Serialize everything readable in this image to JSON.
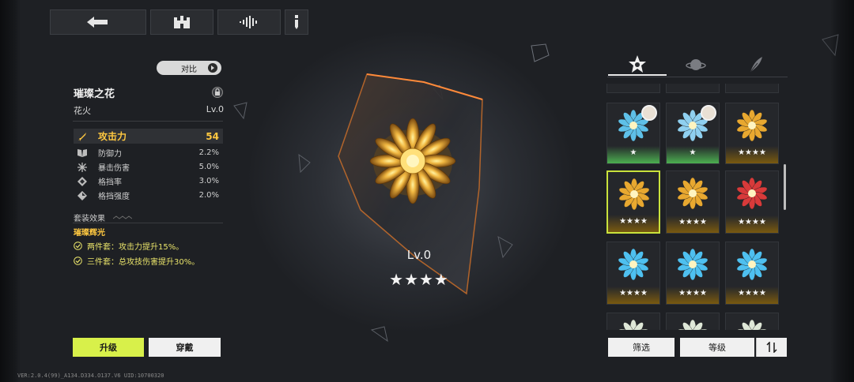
{
  "toolbar": {
    "buttons": [
      {
        "icon": "back-arrow-icon"
      },
      {
        "icon": "castle-icon"
      },
      {
        "icon": "waveform-icon"
      },
      {
        "icon": "info-icon"
      }
    ]
  },
  "left_panel": {
    "compare_label": "对比",
    "item_name": "璀璨之花",
    "item_type": "花火",
    "item_level": "Lv.0",
    "main_stat": {
      "name": "攻击力",
      "value": "54",
      "icon": "sword-icon",
      "color": "#ffc840"
    },
    "sub_stats": [
      {
        "name": "防御力",
        "value": "2.2%",
        "icon": "book-icon"
      },
      {
        "name": "暴击伤害",
        "value": "5.0%",
        "icon": "burst-icon"
      },
      {
        "name": "格挡率",
        "value": "3.0%",
        "icon": "block-icon"
      },
      {
        "name": "格挡强度",
        "value": "2.0%",
        "icon": "block-strength-icon"
      }
    ],
    "set_effect_title": "套装效果",
    "set_name": "璀璨辉光",
    "set_bonuses": [
      "两件套：攻击力提升15%。",
      "三件套：总攻技伤害提升30%。"
    ],
    "upgrade_label": "升级",
    "equip_label": "穿戴",
    "version_text": "VER:2.0.4(99)_A134.D334.O137.V6   UID:10700320"
  },
  "center": {
    "level": "Lv.0",
    "stars": "★★★★",
    "star_count": 4
  },
  "right_panel": {
    "tabs": [
      {
        "icon": "flower-icon",
        "active": true
      },
      {
        "icon": "planet-icon",
        "active": false
      },
      {
        "icon": "feather-icon",
        "active": false
      }
    ],
    "items": [
      {
        "stars": "★",
        "color": "#5ec0e8",
        "glow": "#4caf50",
        "avatar": true
      },
      {
        "stars": "★",
        "color": "#8fd0f0",
        "glow": "#4caf50",
        "avatar": true
      },
      {
        "stars": "★★★★",
        "color": "#e8a830",
        "glow": "#7a5a10",
        "avatar": false
      },
      {
        "stars": "★★★★",
        "color": "#e8a830",
        "glow": "#7a5a10",
        "avatar": false,
        "selected": true
      },
      {
        "stars": "★★★★",
        "color": "#e8a830",
        "glow": "#7a5a10",
        "avatar": false
      },
      {
        "stars": "★★★★",
        "color": "#d83a3a",
        "glow": "#7a5a10",
        "avatar": false
      },
      {
        "stars": "★★★★",
        "color": "#4ec0f0",
        "glow": "#7a5a10",
        "avatar": false
      },
      {
        "stars": "★★★★",
        "color": "#4ec0f0",
        "glow": "#7a5a10",
        "avatar": false
      },
      {
        "stars": "★★★★",
        "color": "#4ec0f0",
        "glow": "#7a5a10",
        "avatar": false
      },
      {
        "stars": "",
        "color": "#dfe8d8",
        "glow": "#25272b",
        "avatar": false
      },
      {
        "stars": "",
        "color": "#dfe8d8",
        "glow": "#25272b",
        "avatar": false
      },
      {
        "stars": "",
        "color": "#dfe8d8",
        "glow": "#25272b",
        "avatar": false
      }
    ],
    "filter_label": "筛选",
    "sort_label": "等级",
    "order_icon": "sort-order-icon"
  }
}
